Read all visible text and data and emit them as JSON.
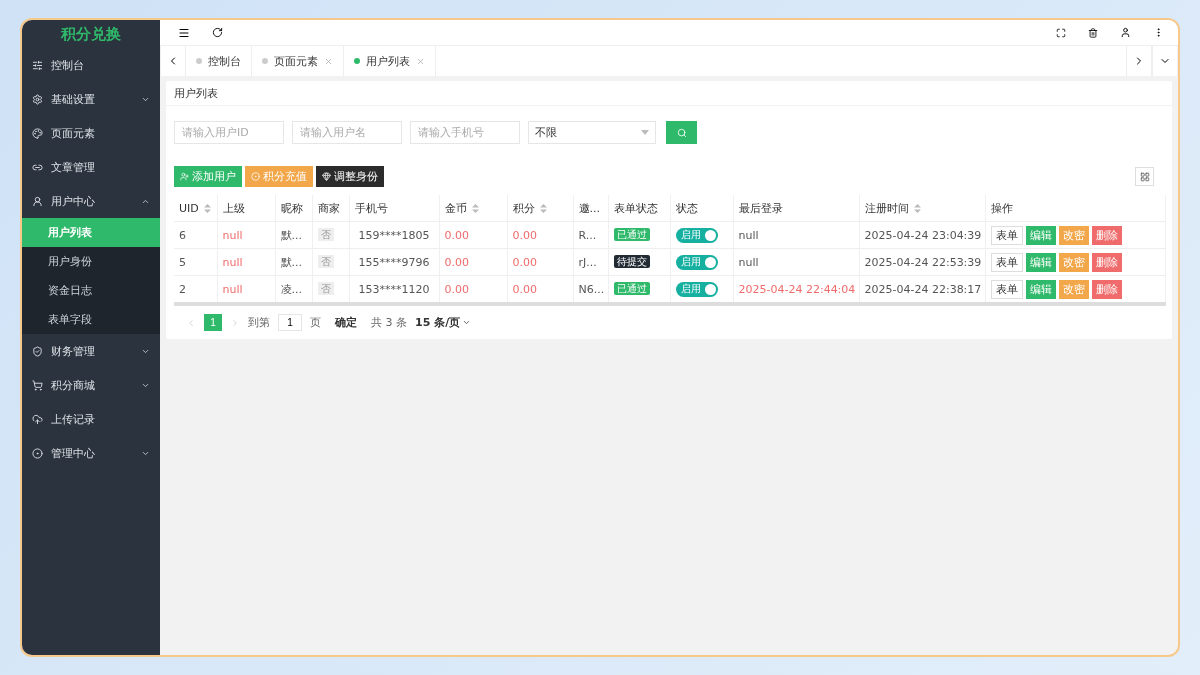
{
  "sidebar": {
    "logo": "积分兑换",
    "items": [
      {
        "label": "控制台",
        "kind": "link"
      },
      {
        "label": "基础设置",
        "kind": "group",
        "expanded": false
      },
      {
        "label": "页面元素",
        "kind": "link"
      },
      {
        "label": "文章管理",
        "kind": "link"
      },
      {
        "label": "用户中心",
        "kind": "group",
        "expanded": true,
        "children": [
          {
            "label": "用户列表",
            "selected": true
          },
          {
            "label": "用户身份",
            "selected": false
          },
          {
            "label": "资金日志",
            "selected": false
          },
          {
            "label": "表单字段",
            "selected": false
          }
        ]
      },
      {
        "label": "财务管理",
        "kind": "group",
        "expanded": false
      },
      {
        "label": "积分商城",
        "kind": "group",
        "expanded": false
      },
      {
        "label": "上传记录",
        "kind": "link"
      },
      {
        "label": "管理中心",
        "kind": "group",
        "expanded": false
      }
    ]
  },
  "tabs": [
    {
      "label": "控制台",
      "selected": false,
      "closable": false
    },
    {
      "label": "页面元素",
      "selected": false,
      "closable": true
    },
    {
      "label": "用户列表",
      "selected": true,
      "closable": true
    }
  ],
  "card_title": "用户列表",
  "filters": {
    "fields": [
      {
        "placeholder": "请输入用户ID"
      },
      {
        "placeholder": "请输入用户名"
      },
      {
        "placeholder": "请输入手机号"
      }
    ],
    "select": {
      "value": "不限"
    }
  },
  "toolbar": [
    {
      "label": "添加用户",
      "kind": "success"
    },
    {
      "label": "积分充值",
      "kind": "warning"
    },
    {
      "label": "调整身份",
      "kind": "dark"
    }
  ],
  "table": {
    "columns": [
      {
        "label": "UID",
        "sortable": true
      },
      {
        "label": "上级",
        "sortable": false
      },
      {
        "label": "昵称",
        "sortable": false
      },
      {
        "label": "商家",
        "sortable": false
      },
      {
        "label": "手机号",
        "sortable": false
      },
      {
        "label": "金币",
        "sortable": true
      },
      {
        "label": "积分",
        "sortable": true
      },
      {
        "label": "邀...",
        "sortable": false
      },
      {
        "label": "表单状态",
        "sortable": false
      },
      {
        "label": "状态",
        "sortable": false
      },
      {
        "label": "最后登录",
        "sortable": false
      },
      {
        "label": "注册时间",
        "sortable": true
      },
      {
        "label": "操作",
        "sortable": false
      }
    ],
    "rows": [
      {
        "uid": "6",
        "parent": "null",
        "nickname": "默...",
        "merchant": "否",
        "phone": "159****1805",
        "coins": "0.00",
        "points": "0.00",
        "invite": "R...",
        "form_status": {
          "label": "已通过",
          "kind": "approved"
        },
        "status": {
          "label": "启用",
          "on": true
        },
        "last_login": {
          "text": "null",
          "highlight": false
        },
        "registered": "2025-04-24 23:04:39",
        "actions": [
          {
            "label": "表单",
            "kind": "plain"
          },
          {
            "label": "编辑",
            "kind": "success"
          },
          {
            "label": "改密",
            "kind": "warning"
          },
          {
            "label": "删除",
            "kind": "danger"
          }
        ]
      },
      {
        "uid": "5",
        "parent": "null",
        "nickname": "默...",
        "merchant": "否",
        "phone": "155****9796",
        "coins": "0.00",
        "points": "0.00",
        "invite": "rJ...",
        "form_status": {
          "label": "待提交",
          "kind": "pending"
        },
        "status": {
          "label": "启用",
          "on": true
        },
        "last_login": {
          "text": "null",
          "highlight": false
        },
        "registered": "2025-04-24 22:53:39",
        "actions": [
          {
            "label": "表单",
            "kind": "plain"
          },
          {
            "label": "编辑",
            "kind": "success"
          },
          {
            "label": "改密",
            "kind": "warning"
          },
          {
            "label": "删除",
            "kind": "danger"
          }
        ]
      },
      {
        "uid": "2",
        "parent": "null",
        "nickname": "凌...",
        "merchant": "否",
        "phone": "153****1120",
        "coins": "0.00",
        "points": "0.00",
        "invite": "N6...",
        "form_status": {
          "label": "已通过",
          "kind": "approved"
        },
        "status": {
          "label": "启用",
          "on": true
        },
        "last_login": {
          "text": "2025-04-24 22:44:04",
          "highlight": true
        },
        "registered": "2025-04-24 22:38:17",
        "actions": [
          {
            "label": "表单",
            "kind": "plain"
          },
          {
            "label": "编辑",
            "kind": "success"
          },
          {
            "label": "改密",
            "kind": "warning"
          },
          {
            "label": "删除",
            "kind": "danger"
          }
        ]
      }
    ]
  },
  "pagination": {
    "pages": [
      {
        "label": "1",
        "selected": true
      }
    ],
    "goto_label": "到第",
    "goto_value": "1",
    "page_unit": "页",
    "confirm": "确定",
    "total": "共 3 条",
    "page_size": "15 条/页"
  }
}
